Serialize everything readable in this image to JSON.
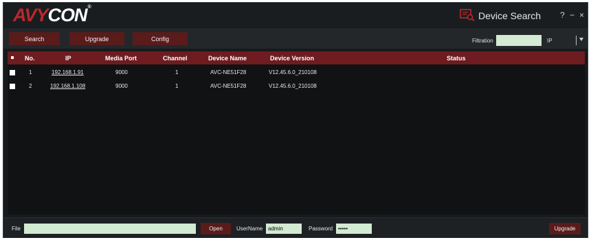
{
  "app": {
    "logo_text_a": "AV",
    "logo_text_y": "Y",
    "logo_text_con": "CON",
    "logo_reg": "®",
    "title": "Device Search",
    "help": "?",
    "minimize": "−",
    "close": "×"
  },
  "toolbar": {
    "search_label": "Search",
    "upgrade_label": "Upgrade",
    "config_label": "Config",
    "filter_label": "Filtration",
    "filter_value": "",
    "filter_type": "IP"
  },
  "table": {
    "headers": {
      "no": "No.",
      "ip": "IP",
      "media_port": "Media Port",
      "channel": "Channel",
      "device_name": "Device Name",
      "device_version": "Device Version",
      "status": "Status"
    },
    "rows": [
      {
        "no": "1",
        "ip": "192.168.1.91",
        "media_port": "9000",
        "channel": "1",
        "device_name": "AVC-NE51F28",
        "device_version": "V12.45.6.0_210108",
        "status": ""
      },
      {
        "no": "2",
        "ip": "192.168.1.108",
        "media_port": "9000",
        "channel": "1",
        "device_name": "AVC-NE51F28",
        "device_version": "V12.45.6.0_210108",
        "status": ""
      }
    ]
  },
  "bottom": {
    "file_label": "File",
    "file_value": "",
    "open_label": "Open",
    "username_label": "UserName",
    "username_value": "admin",
    "password_label": "Password",
    "password_value": "•••••",
    "upgrade_label": "Upgrade"
  },
  "colors": {
    "accent": "#6e1c20",
    "button": "#5a1b1b",
    "input": "#d3ead3",
    "background": "#171a1d"
  },
  "icons": {
    "title_icon": "device-search-icon",
    "dropdown": "chevron-down-icon"
  }
}
